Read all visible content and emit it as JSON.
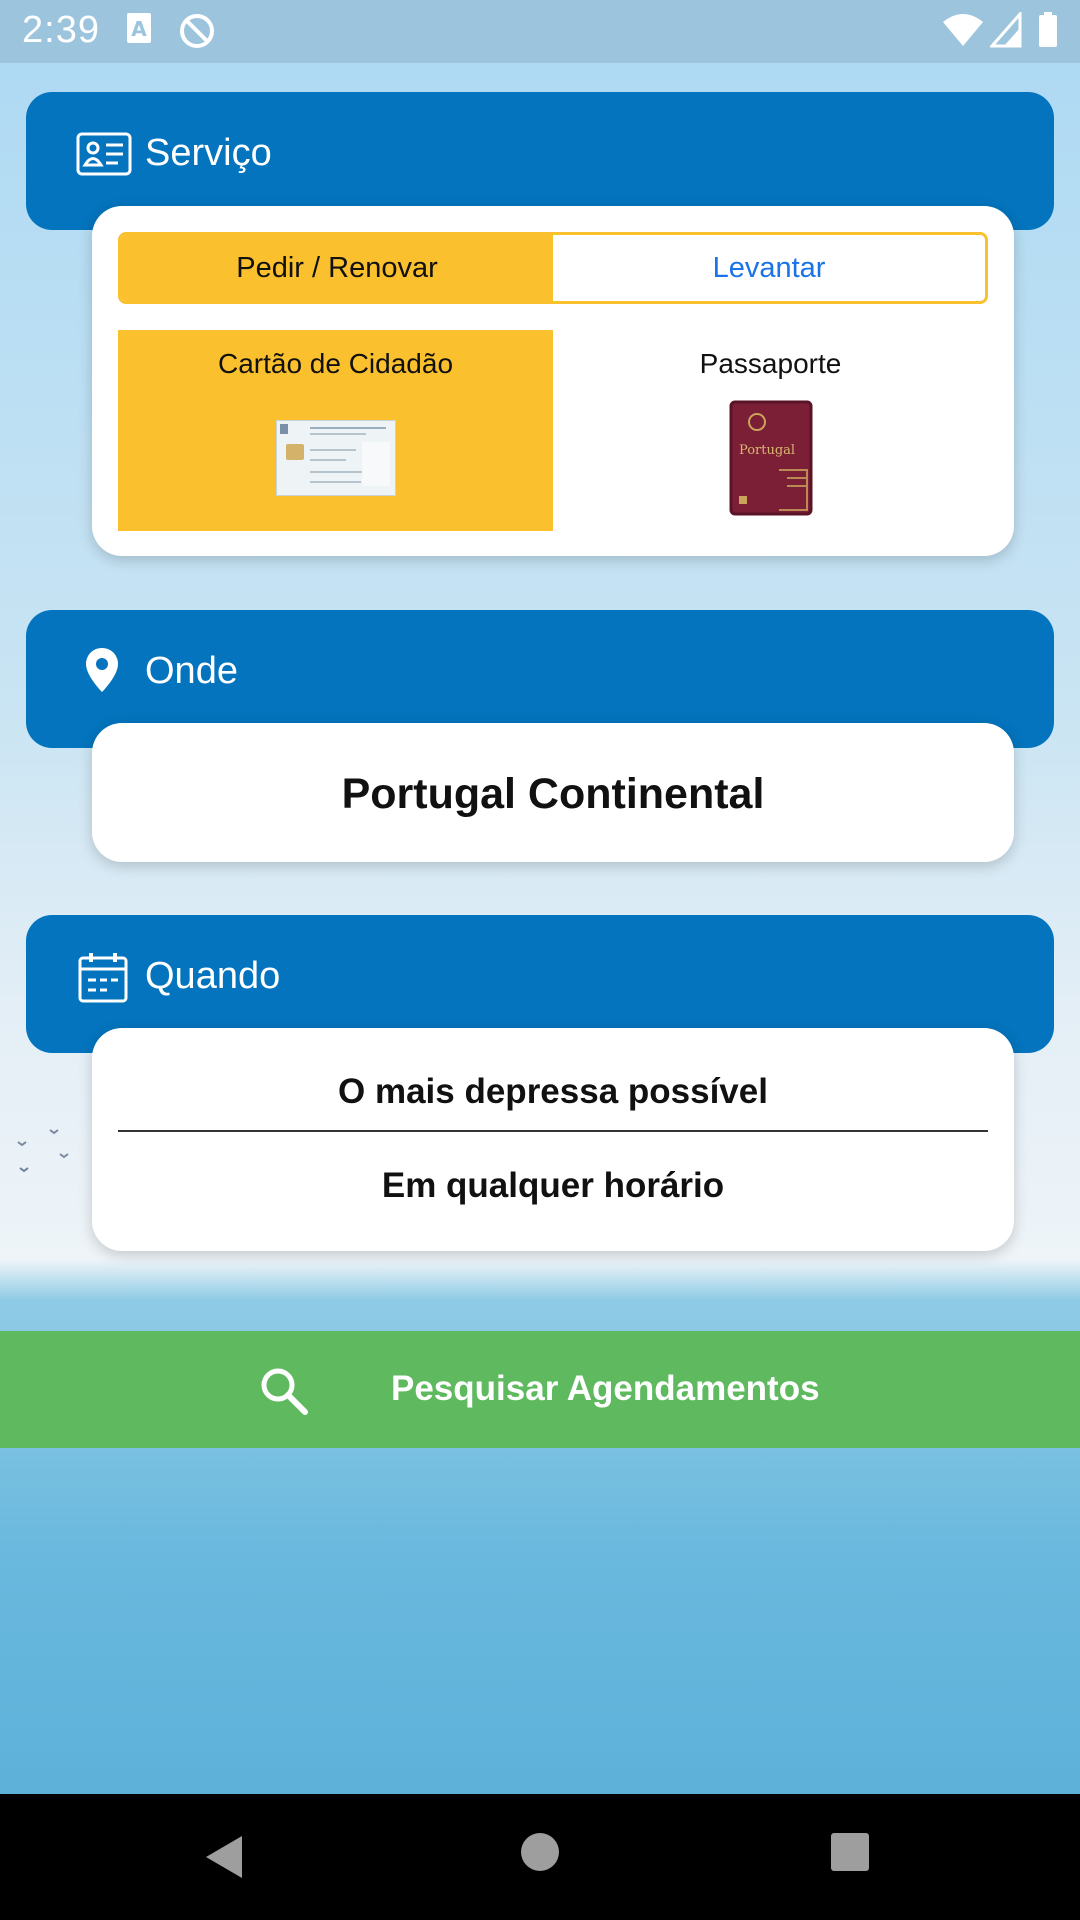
{
  "status_bar": {
    "time": "2:39",
    "icons": [
      "text-a-icon",
      "sync-blocked-icon",
      "wifi-icon",
      "signal-icon",
      "battery-icon"
    ]
  },
  "servico": {
    "title": "Serviço",
    "icon": "id-card-icon",
    "segment": {
      "options": [
        "Pedir / Renovar",
        "Levantar"
      ],
      "selected": "Pedir / Renovar"
    },
    "documents": [
      {
        "label": "Cartão de Cidadão",
        "icon": "citizen-card-image",
        "selected": true
      },
      {
        "label": "Passaporte",
        "icon": "passport-image",
        "selected": false
      }
    ],
    "passport_cover_text": "Portugal"
  },
  "onde": {
    "title": "Onde",
    "icon": "location-pin-icon",
    "value": "Portugal Continental"
  },
  "quando": {
    "title": "Quando",
    "icon": "calendar-icon",
    "option1": "O mais depressa possível",
    "option2": "Em qualquer horário"
  },
  "search_button": {
    "label": "Pesquisar Agendamentos",
    "icon": "search-icon"
  },
  "nav_bar": {
    "buttons": [
      "back-icon",
      "home-icon",
      "recents-icon"
    ]
  },
  "colors": {
    "header_blue": "#0374bd",
    "accent_yellow": "#fbc02d",
    "link_blue": "#1a73e8",
    "button_green": "#5eb95f"
  }
}
